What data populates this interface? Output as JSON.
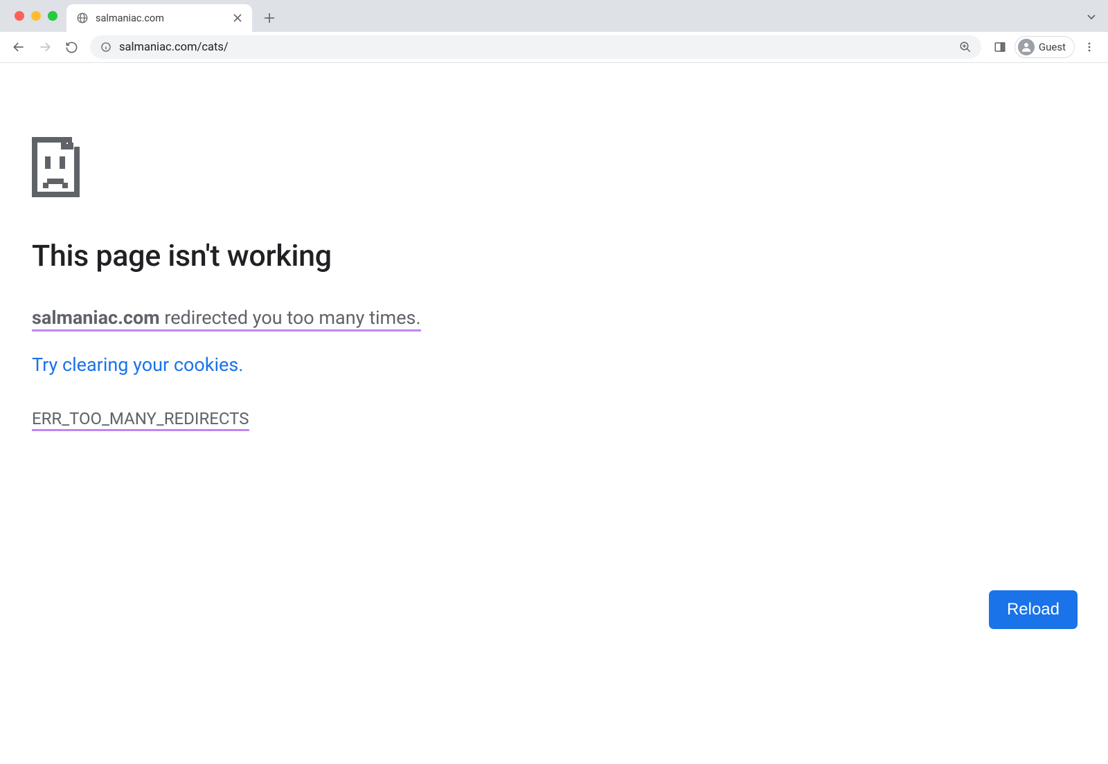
{
  "window": {
    "tab_title": "salmaniac.com"
  },
  "toolbar": {
    "url": "salmaniac.com/cats/",
    "profile_label": "Guest"
  },
  "error": {
    "title": "This page isn't working",
    "domain": "salmaniac.com",
    "message_suffix": " redirected you too many times.",
    "suggestion_link": "Try clearing your cookies",
    "suggestion_dot": ".",
    "code": "ERR_TOO_MANY_REDIRECTS",
    "reload_label": "Reload"
  }
}
